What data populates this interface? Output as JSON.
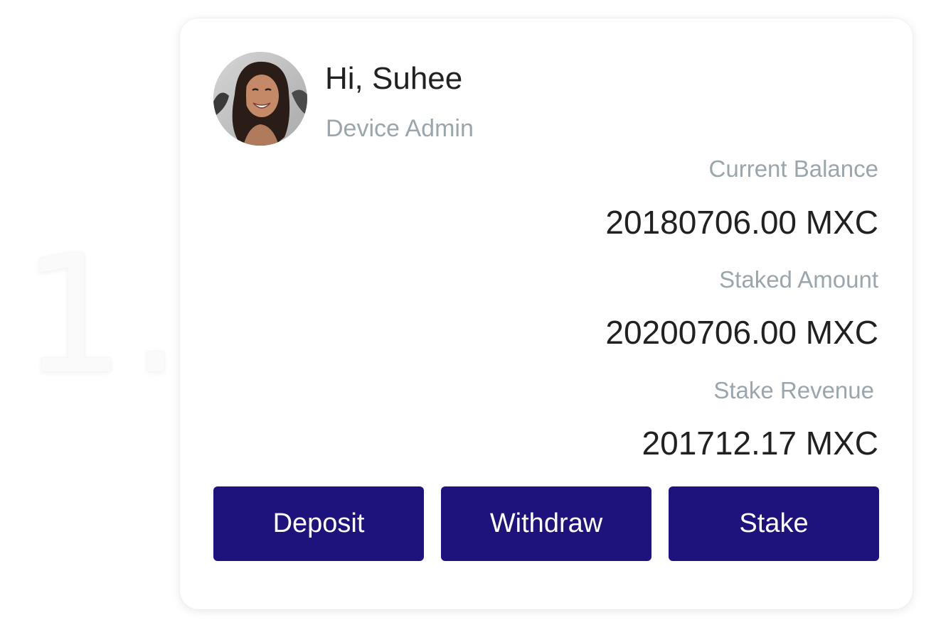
{
  "step": {
    "number": "1."
  },
  "profile": {
    "greeting": "Hi, Suhee",
    "role": "Device Admin",
    "avatar_icon": "user-photo"
  },
  "metrics": [
    {
      "label": "Current Balance",
      "value": "20180706.00 MXC"
    },
    {
      "label": "Staked Amount",
      "value": "20200706.00 MXC"
    },
    {
      "label": "Stake Revenue",
      "value": "201712.17 MXC"
    }
  ],
  "actions": {
    "deposit_label": "Deposit",
    "withdraw_label": "Withdraw",
    "stake_label": "Stake"
  },
  "colors": {
    "button_bg": "#1e137c",
    "label_gray": "#9aa6ac",
    "text_dark": "#212121"
  }
}
